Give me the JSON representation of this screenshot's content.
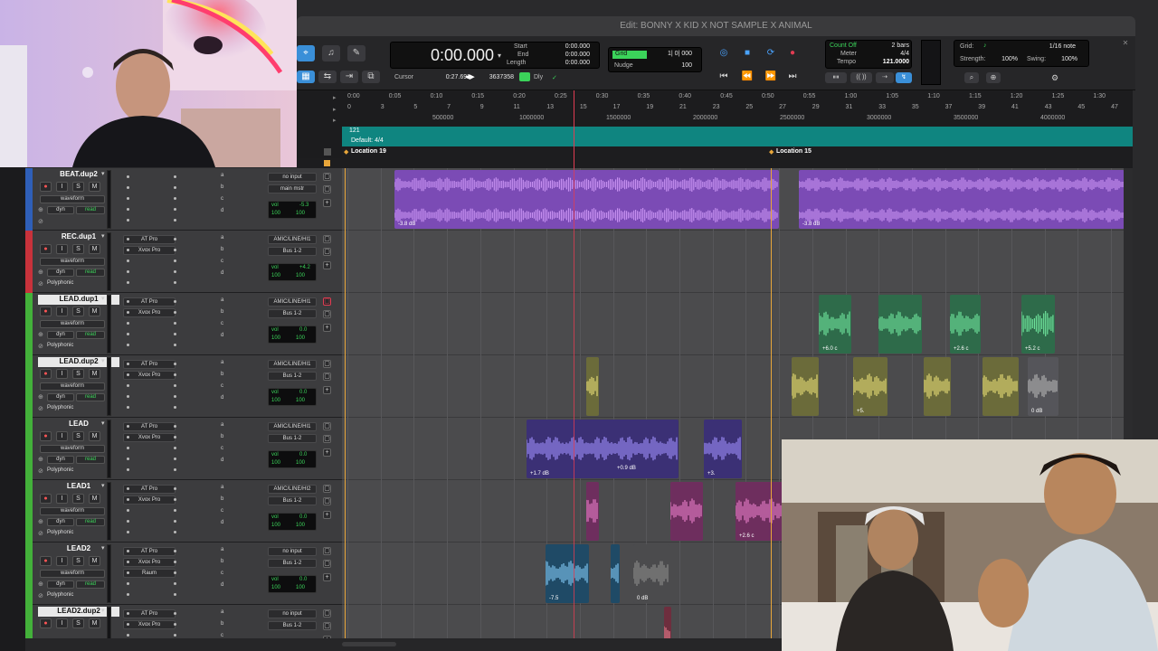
{
  "window": {
    "title": "Edit: BONNY X KID X NOT SAMPLE X ANIMAL"
  },
  "transport": {
    "main_counter": "0:00.000",
    "start_label": "Start",
    "start_value": "0:00.000",
    "end_label": "End",
    "end_value": "0:00.000",
    "length_label": "Length",
    "length_value": "0:00.000",
    "cursor_label": "Cursor",
    "cursor_value": "0:27.692",
    "sample_value": "3637358",
    "dly_label": "Dly",
    "grid_label": "Grid",
    "grid_value": "1| 0| 000",
    "nudge_label": "Nudge",
    "nudge_value": "100",
    "count_off": "Count Off",
    "meter_label": "Meter",
    "tempo_label": "Tempo",
    "bars_value": "2 bars",
    "meter_value": "4/4",
    "tempo_value": "121.0000",
    "quant_grid_label": "Grid:",
    "quant_note": "1/16 note",
    "strength_label": "Strength:",
    "strength_value": "100%",
    "swing_label": "Swing:",
    "swing_value": "100%"
  },
  "ruler": {
    "min_secs": [
      "0:00",
      "0:05",
      "0:10",
      "0:15",
      "0:20",
      "0:25",
      "0:30",
      "0:35",
      "0:40",
      "0:45",
      "0:50",
      "0:55",
      "1:00",
      "1:05",
      "1:10",
      "1:15",
      "1:20",
      "1:25",
      "1:30"
    ],
    "bars": [
      "0",
      "3",
      "5",
      "7",
      "9",
      "11",
      "13",
      "15",
      "17",
      "19",
      "21",
      "23",
      "25",
      "27",
      "29",
      "31",
      "33",
      "35",
      "37",
      "39",
      "41",
      "43",
      "45",
      "47"
    ],
    "samples": [
      "500000",
      "1000000",
      "1500000",
      "2000000",
      "2500000",
      "3000000",
      "3500000",
      "4000000"
    ],
    "tempo_marker": "121",
    "meter_marker": "Default: 4/4",
    "marker1": "Location 19",
    "marker2": "Location 15"
  },
  "tracks": [
    {
      "name": "BEAT.dup2",
      "color": "#2f5fb8",
      "selected": false,
      "plug1": "",
      "plug2": "",
      "plug3": "",
      "input": "no input",
      "output": "main mstr",
      "vol": "-5.3",
      "pan_l": "100",
      "pan_r": "100",
      "mode": "",
      "row_waveform": "waveform",
      "row_dyn": "dyn",
      "row_read": "read",
      "rec_active": false
    },
    {
      "name": "REC.dup1",
      "color": "#c8323b",
      "selected": false,
      "plug1": "AT Pro",
      "plug2": "Xvox Pro",
      "plug3": "",
      "input": "AMIC/LINE/HI1",
      "output": "Bus 1-2",
      "vol": "+4.2",
      "pan_l": "100",
      "pan_r": "100",
      "mode": "Polyphonic",
      "row_waveform": "waveform",
      "row_dyn": "dyn",
      "row_read": "read",
      "rec_active": false
    },
    {
      "name": "LEAD.dup1",
      "color": "#43b13a",
      "selected": true,
      "plug1": "AT Pro",
      "plug2": "Xvox Pro",
      "plug3": "",
      "input": "AMIC/LINE/HI1",
      "output": "Bus 1-2",
      "vol": "0.0",
      "pan_l": "100",
      "pan_r": "100",
      "mode": "Polyphonic",
      "row_waveform": "waveform",
      "row_dyn": "dyn",
      "row_read": "read",
      "rec_active": true
    },
    {
      "name": "LEAD.dup2",
      "color": "#43b13a",
      "selected": true,
      "plug1": "AT Pro",
      "plug2": "Xvox Pro",
      "plug3": "",
      "input": "AMIC/LINE/HI1",
      "output": "Bus 1-2",
      "vol": "0.0",
      "pan_l": "100",
      "pan_r": "100",
      "mode": "Polyphonic",
      "row_waveform": "waveform",
      "row_dyn": "dyn",
      "row_read": "read",
      "rec_active": false
    },
    {
      "name": "LEAD",
      "color": "#43b13a",
      "selected": false,
      "plug1": "AT Pro",
      "plug2": "Xvox Pro",
      "plug3": "",
      "input": "AMIC/LINE/HI1",
      "output": "Bus 1-2",
      "vol": "0.0",
      "pan_l": "100",
      "pan_r": "100",
      "mode": "Polyphonic",
      "row_waveform": "waveform",
      "row_dyn": "dyn",
      "row_read": "read",
      "rec_active": false
    },
    {
      "name": "LEAD1",
      "color": "#43b13a",
      "selected": false,
      "plug1": "AT Pro",
      "plug2": "Xvox Pro",
      "plug3": "",
      "input": "AMIC/LINE/HI2",
      "output": "Bus 1-2",
      "vol": "0.0",
      "pan_l": "100",
      "pan_r": "100",
      "mode": "Polyphonic",
      "row_waveform": "waveform",
      "row_dyn": "dyn",
      "row_read": "read",
      "rec_active": false
    },
    {
      "name": "LEAD2",
      "color": "#43b13a",
      "selected": false,
      "plug1": "AT Pro",
      "plug2": "Xvox Pro",
      "plug3": "Raum",
      "input": "no input",
      "output": "Bus 1-2",
      "vol": "0.0",
      "pan_l": "100",
      "pan_r": "100",
      "mode": "Polyphonic",
      "row_waveform": "waveform",
      "row_dyn": "dyn",
      "row_read": "read",
      "rec_active": false
    },
    {
      "name": "LEAD2.dup2",
      "color": "#43b13a",
      "selected": true,
      "plug1": "AT Pro",
      "plug2": "Xvox Pro",
      "plug3": "",
      "input": "no input",
      "output": "Bus 1-2",
      "vol": "",
      "pan_l": "",
      "pan_r": "",
      "mode": "",
      "row_waveform": "",
      "row_dyn": "",
      "row_read": "",
      "rec_active": false
    }
  ],
  "send_letters": [
    "a",
    "b",
    "c",
    "d"
  ],
  "clips": [
    {
      "lane": 0,
      "start": 58,
      "width": 425,
      "color": "#7b4bb5",
      "wave": "#c58ff0",
      "label": "-3.8 dB",
      "label_pos": "left"
    },
    {
      "lane": 0,
      "start": 505,
      "width": 360,
      "color": "#7b4bb5",
      "wave": "#c58ff0",
      "label": "-3.8 dB",
      "label_pos": "left"
    },
    {
      "lane": 2,
      "start": 527,
      "width": 36,
      "color": "#2e6b4a",
      "wave": "#6ee29a",
      "label": "+6.0 c",
      "label_pos": "left"
    },
    {
      "lane": 2,
      "start": 593,
      "width": 48,
      "color": "#2e6b4a",
      "wave": "#6ee29a",
      "label": "",
      "label_pos": "left"
    },
    {
      "lane": 2,
      "start": 672,
      "width": 34,
      "color": "#2e6b4a",
      "wave": "#6ee29a",
      "label": "+2.6 c",
      "label_pos": "left"
    },
    {
      "lane": 2,
      "start": 751,
      "width": 37,
      "color": "#2e6b4a",
      "wave": "#6ee29a",
      "label": "+5.2 c",
      "label_pos": "left"
    },
    {
      "lane": 3,
      "start": 270,
      "width": 14,
      "color": "#6b6b3a",
      "wave": "#e1d873",
      "label": "",
      "label_pos": "left"
    },
    {
      "lane": 3,
      "start": 497,
      "width": 30,
      "color": "#6b6b3a",
      "wave": "#e1d873",
      "label": "",
      "label_pos": "left"
    },
    {
      "lane": 3,
      "start": 565,
      "width": 38,
      "color": "#6b6b3a",
      "wave": "#e1d873",
      "label": "+5.",
      "label_pos": "left"
    },
    {
      "lane": 3,
      "start": 643,
      "width": 30,
      "color": "#6b6b3a",
      "wave": "#e1d873",
      "label": "",
      "label_pos": "left"
    },
    {
      "lane": 3,
      "start": 708,
      "width": 40,
      "color": "#6b6b3a",
      "wave": "#e1d873",
      "label": "",
      "label_pos": "left"
    },
    {
      "lane": 3,
      "start": 758,
      "width": 34,
      "color": "#55555a",
      "wave": "#b0b0b0",
      "label": "0 dB",
      "label_pos": "left"
    },
    {
      "lane": 4,
      "start": 204,
      "width": 168,
      "color": "#3b3075",
      "wave": "#9a8bf5",
      "label": "+1.7 dB",
      "label_pos": "left"
    },
    {
      "lane": 4,
      "start": 400,
      "width": 42,
      "color": "#3b3075",
      "wave": "#9a8bf5",
      "label": "+3.",
      "label_pos": "left"
    },
    {
      "lane": 5,
      "start": 270,
      "width": 14,
      "color": "#6e2e5e",
      "wave": "#e27ac4",
      "label": "",
      "label_pos": "left"
    },
    {
      "lane": 5,
      "start": 363,
      "width": 36,
      "color": "#6e2e5e",
      "wave": "#e27ac4",
      "label": "",
      "label_pos": "left"
    },
    {
      "lane": 5,
      "start": 435,
      "width": 52,
      "color": "#6e2e5e",
      "wave": "#e27ac4",
      "label": "+2.6 c",
      "label_pos": "left"
    },
    {
      "lane": 6,
      "start": 225,
      "width": 48,
      "color": "#1f4a66",
      "wave": "#7fc4ef",
      "label": "-7.5",
      "label_pos": "left"
    },
    {
      "lane": 6,
      "start": 297,
      "width": 10,
      "color": "#1f4a66",
      "wave": "#7fc4ef",
      "label": "",
      "label_pos": "left"
    },
    {
      "lane": 6,
      "start": 322,
      "width": 40,
      "color": "#4b4b4d",
      "wave": "#888",
      "label": "0 dB",
      "label_pos": "left"
    },
    {
      "lane": 7,
      "start": 356,
      "width": 8,
      "color": "#6e2e3e",
      "wave": "#e27a8a",
      "label": "",
      "label_pos": "left"
    }
  ],
  "extra_clip_labels": [
    {
      "text": "+0.9 dB"
    }
  ]
}
